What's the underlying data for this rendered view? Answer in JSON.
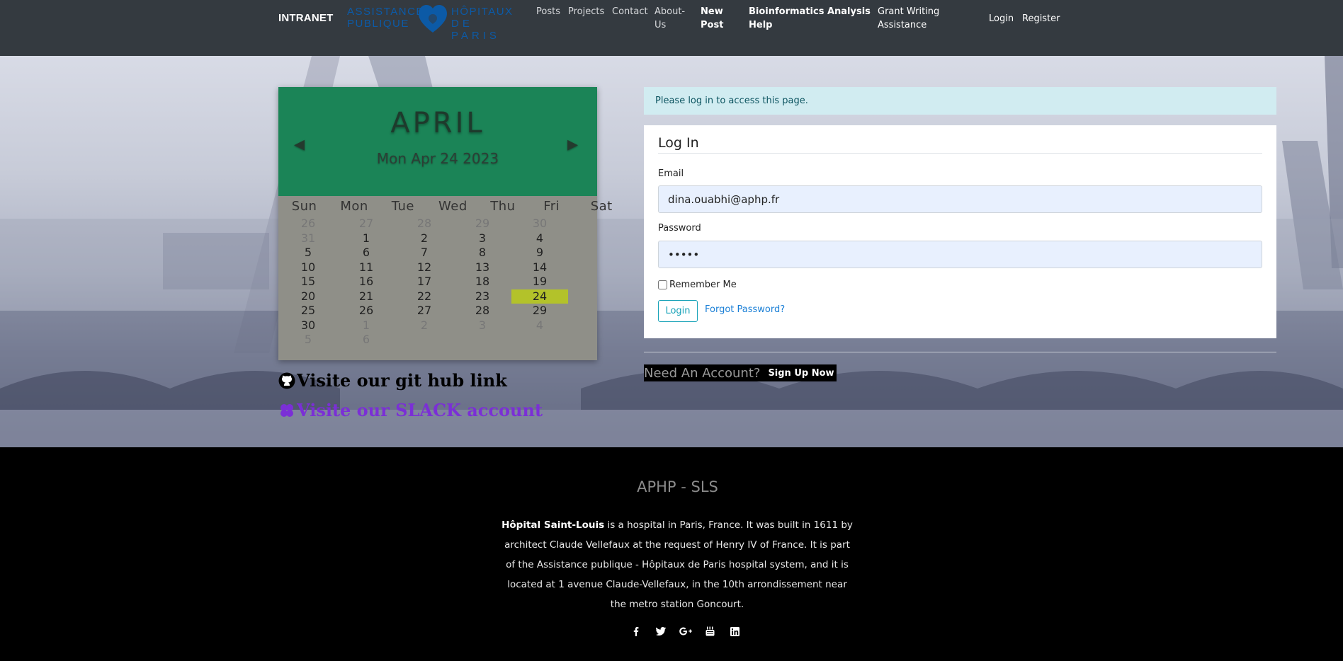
{
  "navbar": {
    "brand": "INTRANET",
    "logo_line1_left": "ASSISTANCE",
    "logo_line2_left": "PUBLIQUE",
    "logo_line1_right": "HÔPITAUX",
    "logo_line2_right": "DE PARIS",
    "links": {
      "posts": "Posts",
      "projects": "Projects",
      "contact": "Contact",
      "about_line1": "About-",
      "about_line2": "Us",
      "new_post_line1": "New",
      "new_post_line2": "Post",
      "bioinfo_line1": "Bioinformatics Analysis",
      "bioinfo_line2": "Help",
      "grant_line1": "Grant Writing",
      "grant_line2": "Assistance",
      "login": "Login",
      "register": "Register"
    }
  },
  "calendar": {
    "month": "APRIL",
    "date_line": "Mon Apr 24 2023",
    "prev_icon": "chevron-left-icon",
    "next_icon": "chevron-right-icon",
    "weekdays": [
      "Sun",
      "Mon",
      "Tue",
      "Wed",
      "Thu",
      "Fri",
      "Sat"
    ],
    "highlight_color": "#b3c22a",
    "header_color": "#1b8457",
    "weeks": [
      [
        [
          "26",
          1
        ],
        [
          "27",
          1
        ],
        [
          "",
          0
        ],
        [
          "28",
          1
        ],
        [
          "29",
          1
        ],
        [
          "30",
          1
        ],
        [
          "",
          0
        ]
      ],
      [
        [
          "31",
          1
        ],
        [
          "1",
          0
        ],
        [
          "",
          0
        ],
        [
          "2",
          0
        ],
        [
          "3",
          0
        ],
        [
          "4",
          0
        ],
        [
          "",
          0
        ]
      ],
      [
        [
          "5",
          0
        ],
        [
          "6",
          0
        ],
        [
          "",
          0
        ],
        [
          "7",
          0
        ],
        [
          "8",
          0
        ],
        [
          "9",
          0
        ],
        [
          "",
          0
        ]
      ],
      [
        [
          "10",
          0
        ],
        [
          "11",
          0
        ],
        [
          "",
          0
        ],
        [
          "12",
          0
        ],
        [
          "13",
          0
        ],
        [
          "14",
          0
        ],
        [
          "",
          0
        ]
      ],
      [
        [
          "15",
          0
        ],
        [
          "16",
          0
        ],
        [
          "",
          0
        ],
        [
          "17",
          0
        ],
        [
          "18",
          0
        ],
        [
          "19",
          0
        ],
        [
          "",
          0
        ]
      ],
      [
        [
          "20",
          0
        ],
        [
          "21",
          0
        ],
        [
          "",
          0
        ],
        [
          "22",
          0
        ],
        [
          "23",
          0
        ],
        [
          "24",
          2
        ],
        [
          "",
          0
        ]
      ],
      [
        [
          "25",
          0
        ],
        [
          "26",
          0
        ],
        [
          "",
          0
        ],
        [
          "27",
          0
        ],
        [
          "28",
          0
        ],
        [
          "29",
          0
        ],
        [
          "",
          0
        ]
      ],
      [
        [
          "30",
          0
        ],
        [
          "1",
          1
        ],
        [
          "",
          0
        ],
        [
          "2",
          1
        ],
        [
          "3",
          1
        ],
        [
          "4",
          1
        ],
        [
          "",
          0
        ]
      ],
      [
        [
          "5",
          1
        ],
        [
          "6",
          1
        ],
        [
          "",
          0
        ],
        [
          "",
          0
        ],
        [
          "",
          0
        ],
        [
          "",
          0
        ],
        [
          "",
          0
        ]
      ]
    ]
  },
  "links": {
    "github": "Visite our git hub link",
    "github_icon": "github-icon",
    "slack": "Visite our SLACK account",
    "slack_icon": "slack-icon",
    "slack_color": "#7b2fd6"
  },
  "login": {
    "alert": "Please log in to access this page.",
    "title": "Log In",
    "email_label": "Email",
    "email_value": "dina.ouabhi@aphp.fr",
    "password_label": "Password",
    "password_value": "•••••",
    "remember": "Remember Me",
    "login_button": "Login",
    "forgot": "Forgot Password?",
    "need_account": "Need An Account?",
    "signup": "Sign Up Now"
  },
  "footer": {
    "title": "APHP - SLS",
    "hospital_name": "Hôpital Saint-Louis",
    "description": " is a hospital in Paris, France. It was built in 1611 by architect Claude Vellefaux at the request of Henry IV of France. It is part of the Assistance publique - Hôpitaux de Paris hospital system, and it is located at 1 avenue Claude-Vellefaux, in the 10th arrondissement near the metro station Goncourt.",
    "social_icons": [
      "facebook-icon",
      "twitter-icon",
      "google-plus-icon",
      "youtube-icon",
      "linkedin-icon"
    ]
  }
}
